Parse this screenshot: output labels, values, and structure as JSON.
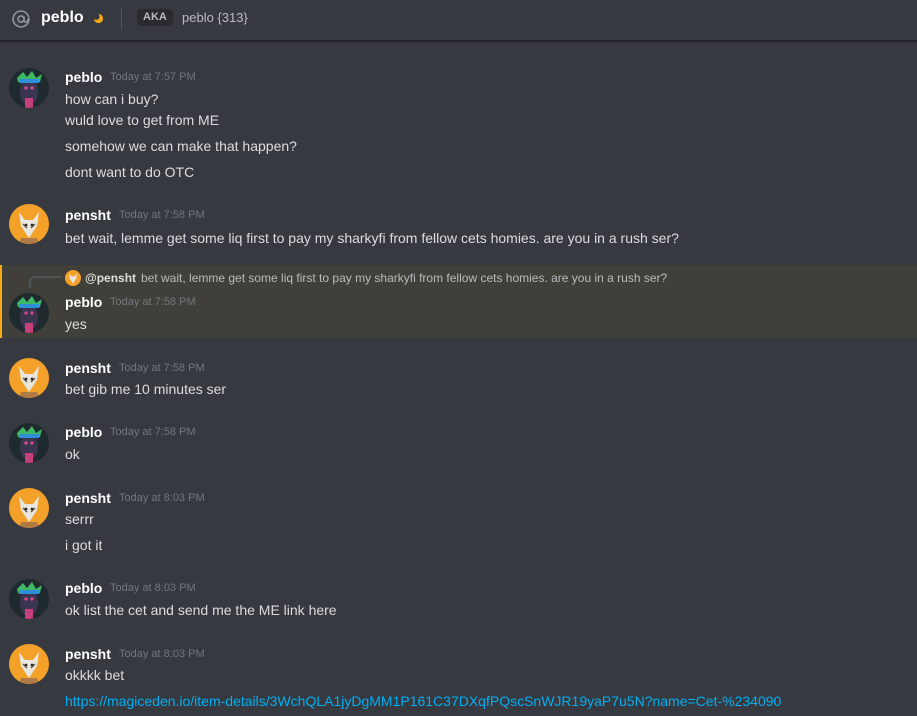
{
  "header": {
    "channel_name": "peblo",
    "aka_label": "AKA",
    "aka_names": "peblo {313}",
    "status": "idle"
  },
  "colors": {
    "background": "#36393f",
    "author": "#ffffff",
    "timestamp": "#72767d",
    "link": "#00aff4",
    "mention_highlight": "#413f39",
    "mention_border": "#faa81a"
  },
  "messages": [
    {
      "author": "peblo",
      "timestamp": "Today at 7:57 PM",
      "avatar": "peblo-avatar",
      "lines": [
        "how can i buy?",
        "wuld love to get from ME",
        "somehow we can make that happen?",
        "dont want to do OTC"
      ]
    },
    {
      "author": "pensht",
      "timestamp": "Today at 7:58 PM",
      "avatar": "pensht-avatar",
      "lines": [
        "bet wait, lemme get some liq first to pay my sharkyfi from fellow cets homies. are you in a rush ser?"
      ]
    },
    {
      "author": "peblo",
      "timestamp": "Today at 7:58 PM",
      "avatar": "peblo-avatar",
      "highlighted": true,
      "reply_to": {
        "author": "@pensht",
        "text": "bet wait, lemme get some liq first to pay my sharkyfi from fellow cets homies. are you in a rush ser?"
      },
      "lines": [
        "yes"
      ]
    },
    {
      "author": "pensht",
      "timestamp": "Today at 7:58 PM",
      "avatar": "pensht-avatar",
      "lines": [
        "bet gib me 10 minutes ser"
      ]
    },
    {
      "author": "peblo",
      "timestamp": "Today at 7:58 PM",
      "avatar": "peblo-avatar",
      "lines": [
        "ok"
      ]
    },
    {
      "author": "pensht",
      "timestamp": "Today at 8:03 PM",
      "avatar": "pensht-avatar",
      "lines": [
        "serrr",
        "i got it"
      ]
    },
    {
      "author": "peblo",
      "timestamp": "Today at 8:03 PM",
      "avatar": "peblo-avatar",
      "lines": [
        "ok list the cet and send me the ME link here"
      ]
    },
    {
      "author": "pensht",
      "timestamp": "Today at 8:03 PM",
      "avatar": "pensht-avatar",
      "lines": [
        "okkkk bet"
      ],
      "link": "https://magiceden.io/item-details/3WchQLA1jyDgMM1P161C37DXqfPQscSnWJR19yaP7u5N?name=Cet-%234090"
    }
  ]
}
